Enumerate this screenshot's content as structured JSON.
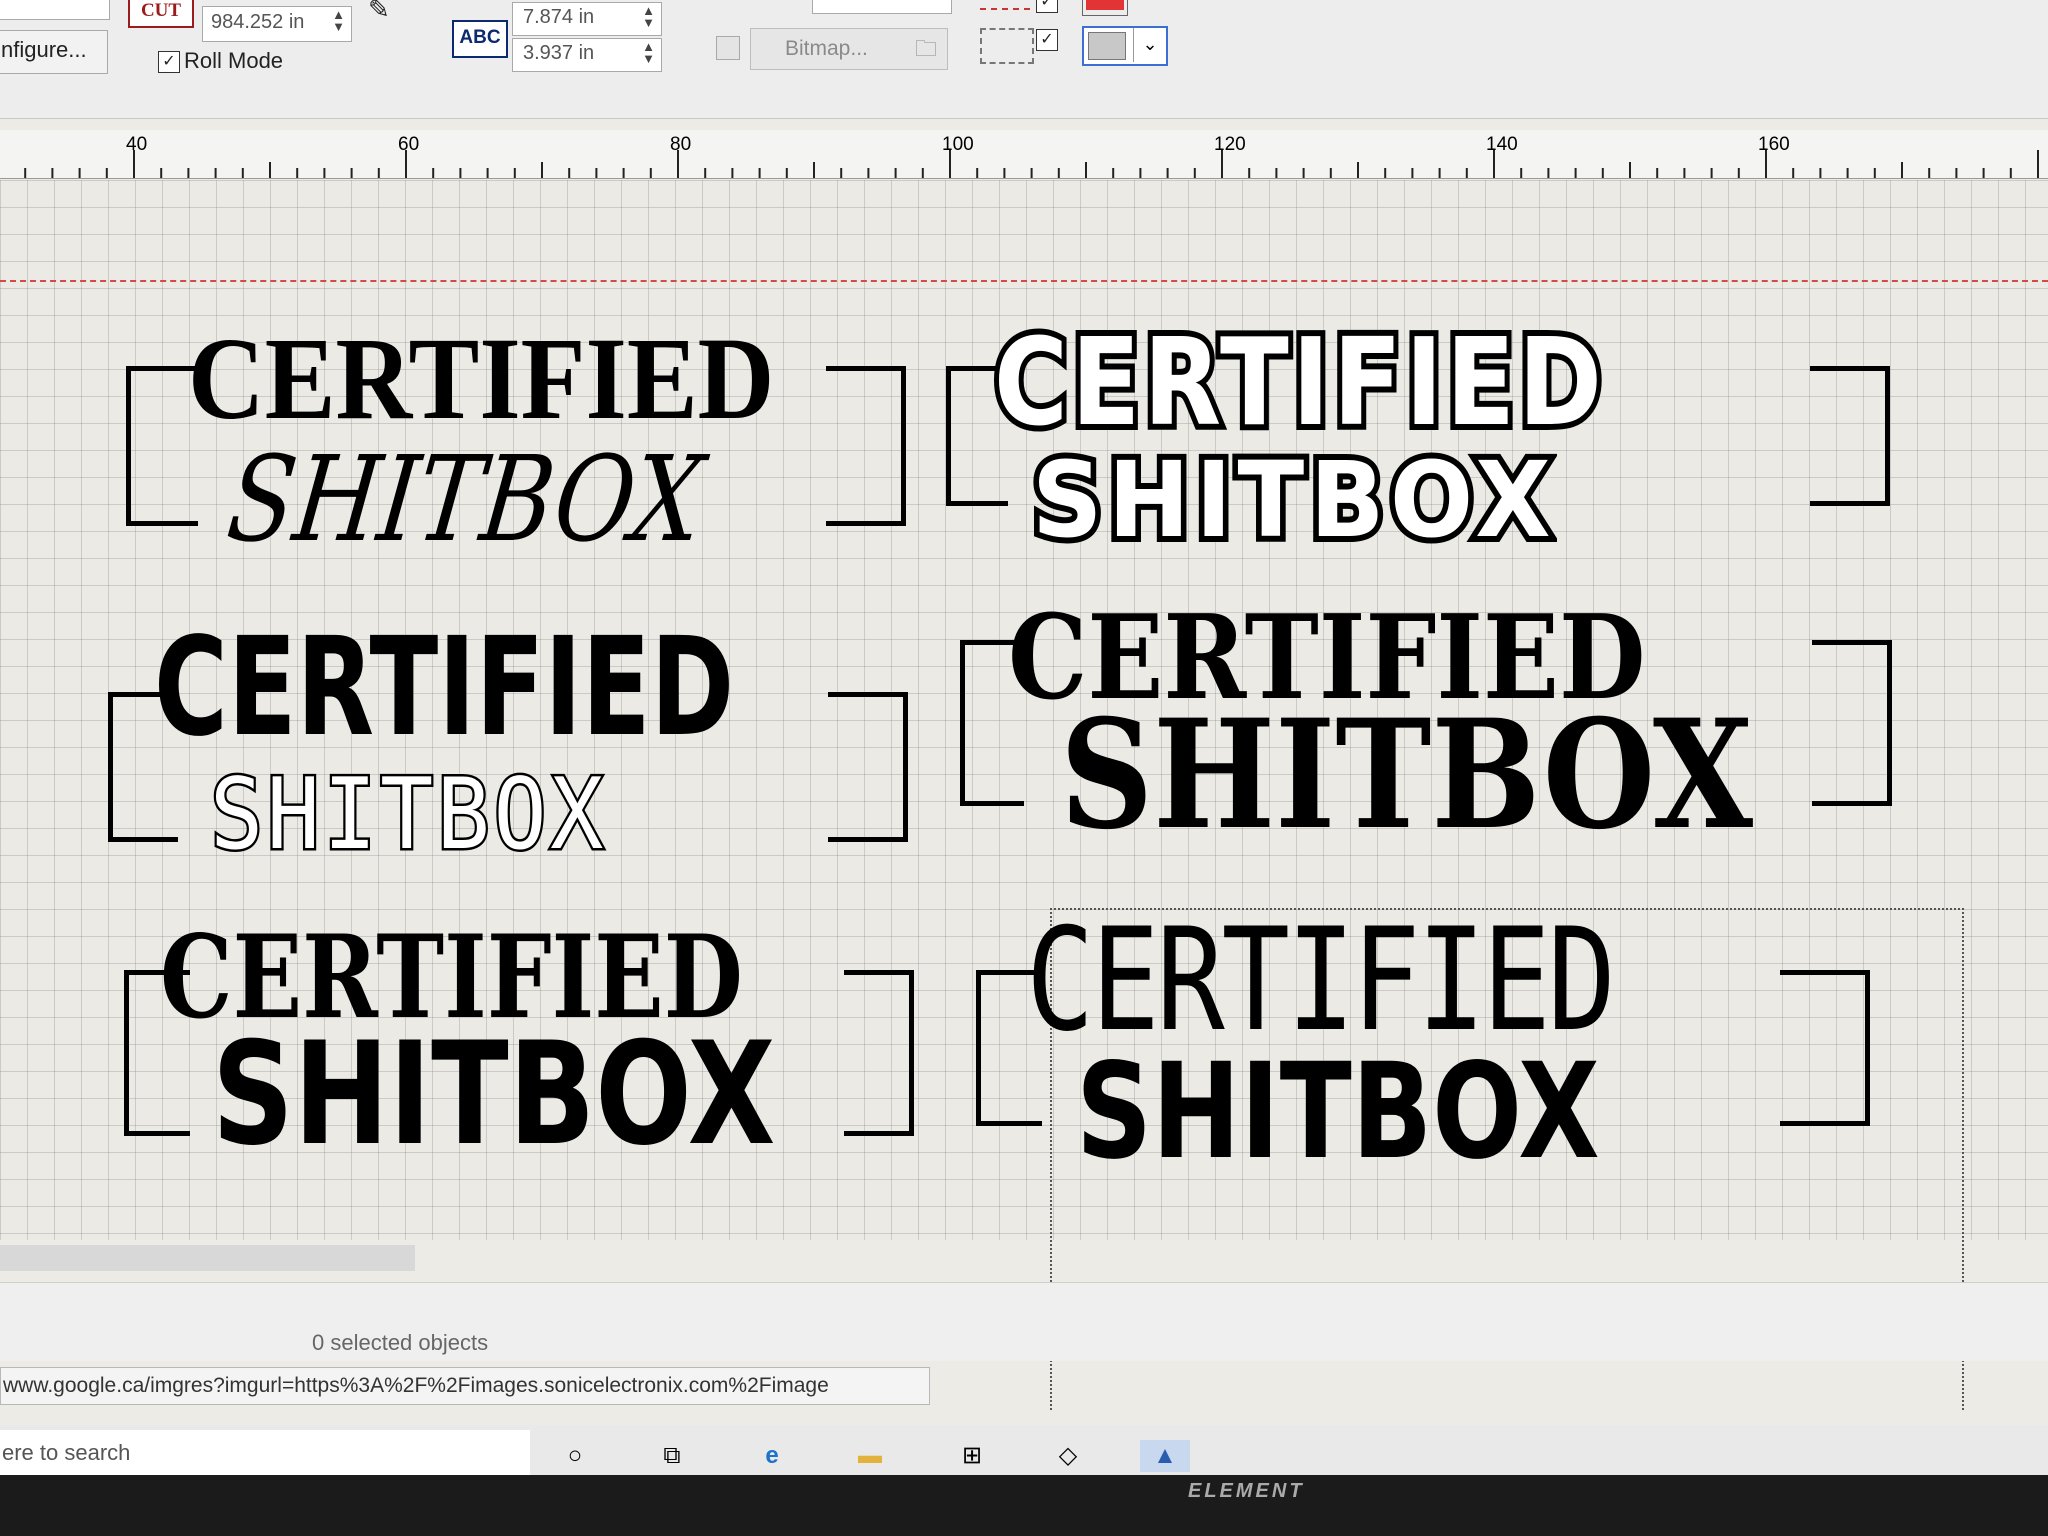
{
  "toolbar": {
    "cut_label": "CUT",
    "roll_length": "984.252 in",
    "configure_label": "nfigure...",
    "roll_mode_label": "Roll Mode",
    "roll_mode_checked": true,
    "abc_label": "ABC",
    "width_value": "7.874 in",
    "height_value": "3.937 in",
    "bitmap_label": "Bitmap...",
    "swatch_colors": [
      "#e23434",
      "#c8c8c8"
    ]
  },
  "ruler": {
    "ticks": [
      "40",
      "60",
      "80",
      "100",
      "120",
      "140",
      "160"
    ]
  },
  "designs": [
    {
      "top": "CERTIFIED",
      "bottom": "SHITBOX"
    },
    {
      "top": "CERTIFIED",
      "bottom": "SHITBOX"
    },
    {
      "top": "CERTIFIED",
      "bottom": "SHITBOX"
    },
    {
      "top": "CERTIFIED",
      "bottom": "SHITBOX"
    },
    {
      "top": "CERTIFIED",
      "bottom": "SHITBOX"
    },
    {
      "top": "CERTIFIED",
      "bottom": "SHITBOX"
    }
  ],
  "status": {
    "selection": "0 selected objects"
  },
  "browser": {
    "url": "www.google.ca/imgres?imgurl=https%3A%2F%2Fimages.sonicelectronix.com%2Fimage"
  },
  "taskbar": {
    "search_placeholder": "ere to search"
  },
  "monitor": {
    "brand": "ELEMENT"
  }
}
